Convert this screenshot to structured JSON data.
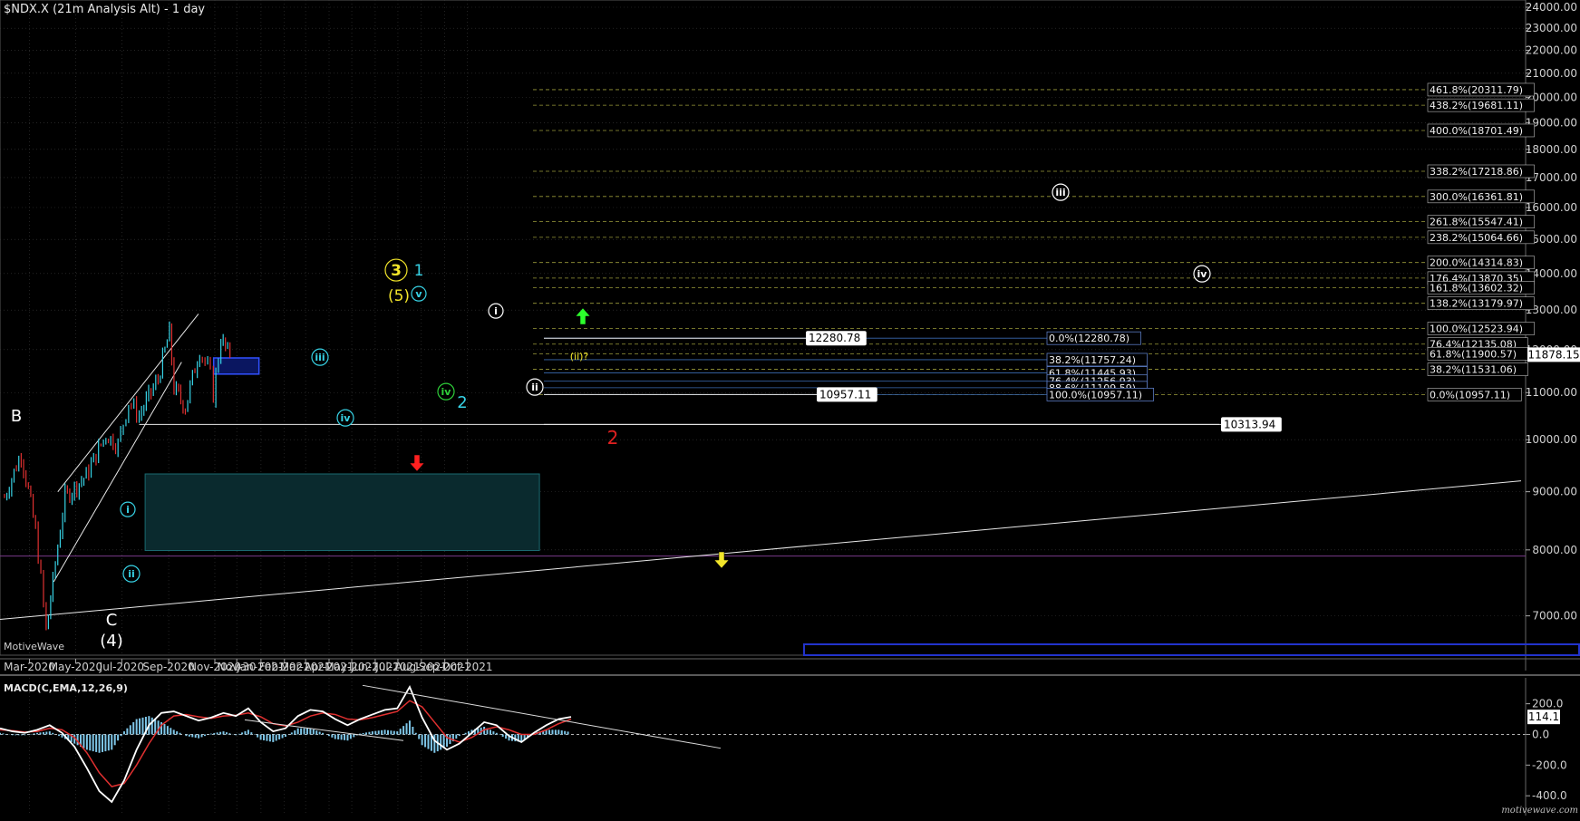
{
  "window": {
    "title": "$NDX.X (21m Analysis Alt) - 1 day",
    "watermark": "MotiveWave",
    "brand": "motivewave.com"
  },
  "colors": {
    "background": "#000000",
    "grid": "#3a3a3a",
    "axis_text": "#d0d0d0",
    "bar_up": "#37d3e6",
    "bar_down": "#e03030",
    "fib_line": "#9a9a3a",
    "macd_line": "#ffffff",
    "signal_line": "#e03030",
    "histogram": "#7ec6e8",
    "label_cyan": "#37d3e6",
    "label_yellow": "#f2e52a",
    "label_green": "#2fd03a",
    "label_red": "#e02020",
    "label_white": "#ffffff",
    "target_box": "#1a6a70"
  },
  "chart_data": [
    {
      "type": "line",
      "title": "$NDX.X (21m Analysis Alt) - 1 day",
      "x_axis_labels": [
        "Mar-2020",
        "May-2020",
        "Jul-2020",
        "Sep-2020",
        "Nov-2020",
        "Nov-30",
        "Jan-2021",
        "Feb-2021",
        "Mar-2021",
        "Apr-2021",
        "May-2021",
        "Jun-2021",
        "Jul-2021",
        "Aug-2021",
        "Sep-2021",
        "Oct-2021"
      ],
      "y_axis_labels": [
        "24000.00",
        "23000.00",
        "22000.00",
        "21000.00",
        "20000.00",
        "19000.00",
        "18000.00",
        "17000.00",
        "16000.00",
        "15000.00",
        "14000.00",
        "13000.00",
        "12000.00",
        "11000.00",
        "10000.00",
        "9000.00",
        "8000.00",
        "7000.00"
      ],
      "y_axis_values": [
        24000,
        23000,
        22000,
        21000,
        20000,
        19000,
        18000,
        17000,
        16000,
        15000,
        14000,
        13000,
        12000,
        11000,
        10000,
        9000,
        8000,
        7000
      ],
      "log_scale": true,
      "grid": true,
      "last_price": "11878.15",
      "price_path": [
        {
          "date": "2020-01-28",
          "value": 8900
        },
        {
          "date": "2020-02-19",
          "value": 9720
        },
        {
          "date": "2020-03-09",
          "value": 8300
        },
        {
          "date": "2020-03-23",
          "value": 6780
        },
        {
          "date": "2020-04-01",
          "value": 7500
        },
        {
          "date": "2020-04-17",
          "value": 8900
        },
        {
          "date": "2020-05-15",
          "value": 9300
        },
        {
          "date": "2020-06-10",
          "value": 10100
        },
        {
          "date": "2020-06-26",
          "value": 9900
        },
        {
          "date": "2020-07-10",
          "value": 10800
        },
        {
          "date": "2020-07-24",
          "value": 10500
        },
        {
          "date": "2020-08-18",
          "value": 11300
        },
        {
          "date": "2020-09-02",
          "value": 12420
        },
        {
          "date": "2020-09-08",
          "value": 11100
        },
        {
          "date": "2020-09-23",
          "value": 10680
        },
        {
          "date": "2020-10-12",
          "value": 12000
        },
        {
          "date": "2020-10-26",
          "value": 11400
        },
        {
          "date": "2020-10-30",
          "value": 10957.11
        },
        {
          "date": "2020-11-09",
          "value": 12280.78
        },
        {
          "date": "2020-11-18",
          "value": 11900
        },
        {
          "date": "2020-11-24",
          "value": 12000
        }
      ],
      "fib_levels_right": [
        {
          "label": "461.8%(20311.79)",
          "value": 20311.79
        },
        {
          "label": "438.2%(19681.11)",
          "value": 19681.11
        },
        {
          "label": "400.0%(18701.49)",
          "value": 18701.49
        },
        {
          "label": "338.2%(17218.86)",
          "value": 17218.86
        },
        {
          "label": "300.0%(16361.81)",
          "value": 16361.81
        },
        {
          "label": "261.8%(15547.41)",
          "value": 15547.41
        },
        {
          "label": "238.2%(15064.66)",
          "value": 15064.66
        },
        {
          "label": "200.0%(14314.83)",
          "value": 14314.83
        },
        {
          "label": "176.4%(13870.35)",
          "value": 13870.35
        },
        {
          "label": "161.8%(13602.32)",
          "value": 13602.32
        },
        {
          "label": "138.2%(13179.97)",
          "value": 13179.97
        },
        {
          "label": "100.0%(12523.94)",
          "value": 12523.94
        },
        {
          "label": "76.4%(12135.08)",
          "value": 12135.08
        },
        {
          "label": "61.8%(11900.57)",
          "value": 11900.57
        },
        {
          "label": "38.2%(11531.06)",
          "value": 11531.06
        },
        {
          "label": "0.0%(10957.11)",
          "value": 10957.11
        }
      ],
      "fib_levels_mid": [
        {
          "label": "0.0%(12280.78)",
          "value": 12280.78
        },
        {
          "label": "38.2%(11757.24)",
          "value": 11757.24
        },
        {
          "label": "61.8%(11445.93)",
          "value": 11445.93
        },
        {
          "label": "76.4%(11256.93)",
          "value": 11256.93
        },
        {
          "label": "88.6%(11109.59)",
          "value": 11109.59
        },
        {
          "label": "100.0%(10957.11)",
          "value": 10957.11
        }
      ],
      "price_tags": [
        {
          "label": "12280.78",
          "value": 12280.78
        },
        {
          "label": "10957.11",
          "value": 10957.11
        },
        {
          "label": "10313.94",
          "value": 10313.94
        }
      ],
      "wave_labels": [
        {
          "text": "B",
          "color": "white"
        },
        {
          "text": "C",
          "color": "white"
        },
        {
          "text": "(4)",
          "color": "white"
        },
        {
          "text": "i",
          "color": "cyan",
          "circled": true
        },
        {
          "text": "ii",
          "color": "cyan",
          "circled": true
        },
        {
          "text": "iii",
          "color": "cyan",
          "circled": true
        },
        {
          "text": "iv",
          "color": "cyan",
          "circled": true
        },
        {
          "text": "v",
          "color": "cyan",
          "circled": true
        },
        {
          "text": "3",
          "color": "yellow",
          "circled": true
        },
        {
          "text": "(5)",
          "color": "yellow"
        },
        {
          "text": "1",
          "color": "cyan"
        },
        {
          "text": "iv",
          "color": "green",
          "circled": true
        },
        {
          "text": "2",
          "color": "cyan"
        },
        {
          "text": "i",
          "color": "white",
          "circled": true
        },
        {
          "text": "ii",
          "color": "white",
          "circled": true
        },
        {
          "text": "iii",
          "color": "white",
          "circled": true
        },
        {
          "text": "iv",
          "color": "white",
          "circled": true
        },
        {
          "text": "2",
          "color": "red"
        },
        {
          "text": "(ii)?",
          "color": "yellow"
        }
      ]
    },
    {
      "type": "line",
      "title": "MACD(C,EMA,12,26,9)",
      "y_axis_labels": [
        "200.0",
        "0.0",
        "-200.0",
        "-400.0"
      ],
      "y_axis_values": [
        200,
        0,
        -200,
        -400
      ],
      "last_value": "114.1",
      "series": [
        {
          "values": [
            40,
            20,
            10,
            30,
            60,
            10,
            -80,
            -220,
            -370,
            -440,
            -300,
            -100,
            60,
            140,
            150,
            120,
            90,
            110,
            140,
            120,
            170,
            80,
            20,
            40,
            120,
            160,
            150,
            100,
            60,
            100,
            130,
            160,
            170,
            310,
            110,
            -40,
            -100,
            -60,
            10,
            80,
            60,
            -10,
            -50,
            10,
            60,
            100,
            114.1
          ]
        },
        {
          "values": [
            30,
            25,
            15,
            20,
            40,
            30,
            -20,
            -120,
            -250,
            -340,
            -320,
            -200,
            -60,
            60,
            120,
            130,
            115,
            105,
            120,
            125,
            140,
            115,
            70,
            55,
            80,
            120,
            140,
            130,
            100,
            95,
            110,
            130,
            150,
            220,
            180,
            80,
            -20,
            -50,
            -20,
            30,
            50,
            30,
            0,
            0,
            30,
            70,
            100
          ]
        }
      ]
    }
  ]
}
